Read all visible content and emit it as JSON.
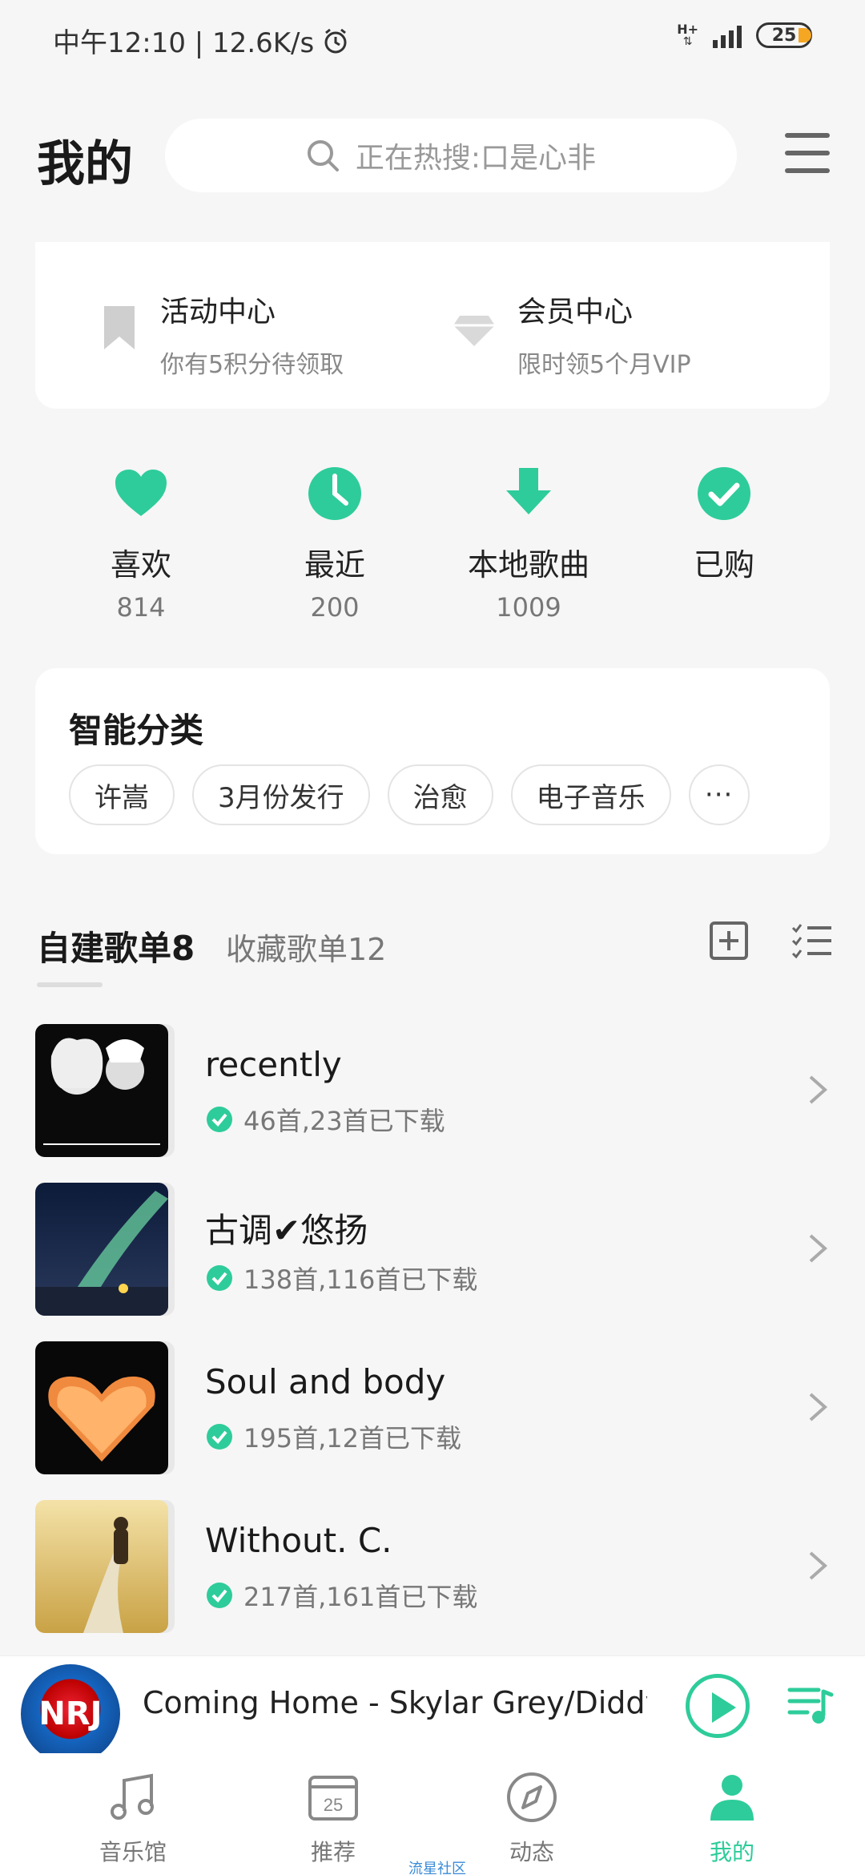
{
  "status_bar": {
    "time_speed": "中午12:10 | 12.6K/s",
    "network": "H+",
    "battery": "25"
  },
  "header": {
    "title": "我的",
    "search_placeholder": "正在热搜:口是心非"
  },
  "activity": {
    "event_title": "活动中心",
    "event_sub": "你有5积分待领取",
    "vip_title": "会员中心",
    "vip_sub": "限时领5个月VIP"
  },
  "stats": [
    {
      "label": "喜欢",
      "count": "814",
      "icon": "heart-icon"
    },
    {
      "label": "最近",
      "count": "200",
      "icon": "clock-icon"
    },
    {
      "label": "本地歌曲",
      "count": "1009",
      "icon": "download-icon"
    },
    {
      "label": "已购",
      "count": "",
      "icon": "check-icon"
    }
  ],
  "smart": {
    "title": "智能分类",
    "chips": [
      "许嵩",
      "3月份发行",
      "治愈",
      "电子音乐"
    ],
    "more": "···"
  },
  "playlists_header": {
    "own": "自建歌单8",
    "fav": "收藏歌单12"
  },
  "playlists": [
    {
      "name": "recently",
      "meta": "46首,23首已下载"
    },
    {
      "name": "古调✔悠扬",
      "meta": "138首,116首已下载"
    },
    {
      "name": "Soul and body",
      "meta": "195首,12首已下载"
    },
    {
      "name": "Without. C.",
      "meta": "217首,161首已下载"
    }
  ],
  "player": {
    "now_playing": "Coming Home - Skylar Grey/Diddy-D",
    "art_text": "NRJ"
  },
  "nav": {
    "items": [
      "音乐馆",
      "推荐",
      "动态",
      "我的"
    ],
    "calendar_day": "25",
    "tip": "流星社区"
  },
  "colors": {
    "accent": "#2ecc9a",
    "background": "#f6f6f6"
  }
}
